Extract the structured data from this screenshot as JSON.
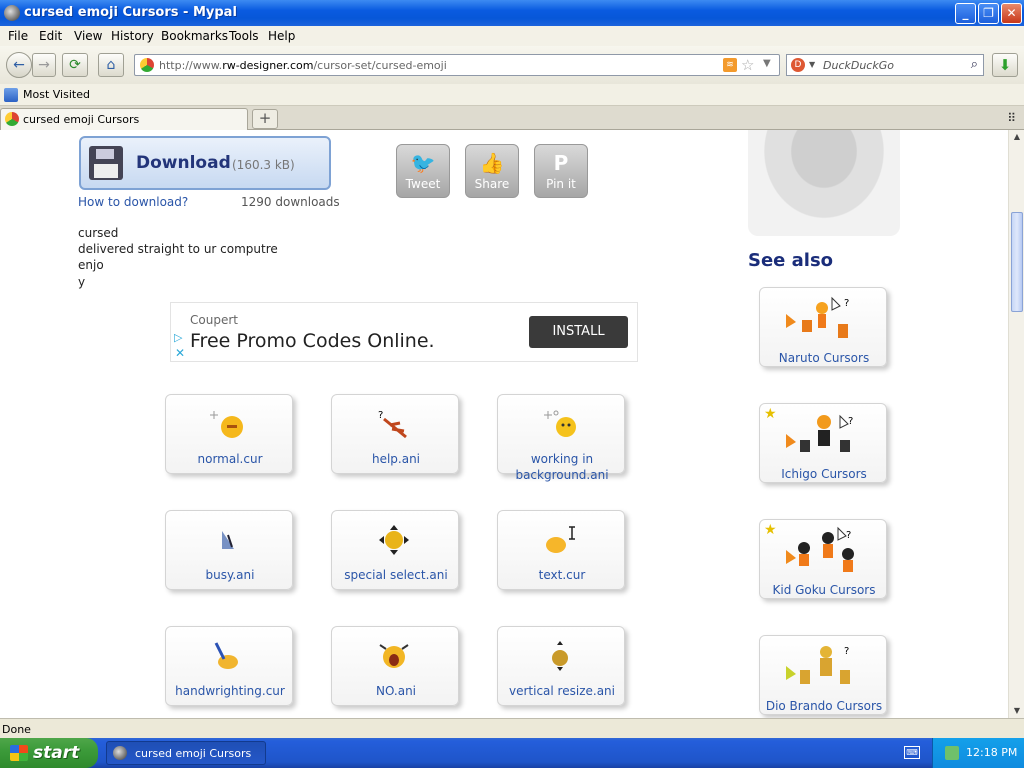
{
  "window": {
    "title": "cursed emoji Cursors - Mypal",
    "minimize": "_",
    "maximize": "❐",
    "close": "✕"
  },
  "menu": [
    "File",
    "Edit",
    "View",
    "History",
    "Bookmarks",
    "Tools",
    "Help"
  ],
  "nav": {
    "back_icon": "←",
    "forward_icon": "→",
    "reload_icon": "⟳",
    "home_icon": "⌂",
    "url_prefix": "http://www.",
    "url_domain": "rw-designer.com",
    "url_path": "/cursor-set/cursed-emoji",
    "search_placeholder": "DuckDuckGo",
    "search_icon": "⌕",
    "download_icon": "⬇"
  },
  "bookmarks": {
    "most_visited": "Most Visited"
  },
  "tabs": [
    {
      "label": "cursed emoji Cursors"
    }
  ],
  "page": {
    "download_label": "Download",
    "download_size": "(160.3 kB)",
    "how_to_download": "How to download?",
    "download_count": "1290 downloads",
    "description": [
      "cursed",
      "delivered straight to ur computre",
      "enjo",
      "y"
    ],
    "share": [
      {
        "label": "Tweet",
        "glyph": "🐦"
      },
      {
        "label": "Share",
        "glyph": "👍"
      },
      {
        "label": "Pin it",
        "glyph": "P"
      }
    ],
    "ad": {
      "brand": "Coupert",
      "headline": "Free Promo Codes Online.",
      "button": "INSTALL"
    },
    "cursors": [
      {
        "name": "normal.cur"
      },
      {
        "name": "help.ani"
      },
      {
        "name": "working in background.ani"
      },
      {
        "name": "busy.ani"
      },
      {
        "name": "special select.ani"
      },
      {
        "name": "text.cur"
      },
      {
        "name": "handwrighting.cur"
      },
      {
        "name": "NO.ani"
      },
      {
        "name": "vertical resize.ani"
      }
    ],
    "see_also_title": "See also",
    "see_also": [
      {
        "name": "Naruto Cursors"
      },
      {
        "name": "Ichigo Cursors"
      },
      {
        "name": "Kid Goku Cursors"
      },
      {
        "name": "Dio Brando Cursors"
      }
    ]
  },
  "status": {
    "text": "Done"
  },
  "taskbar": {
    "start": "start",
    "task": "cursed emoji Cursors ...",
    "clock": "12:18 PM"
  },
  "colors": {
    "link": "#2a55a8",
    "heading": "#1a2d7a",
    "titlebar": "#0a5be0"
  }
}
